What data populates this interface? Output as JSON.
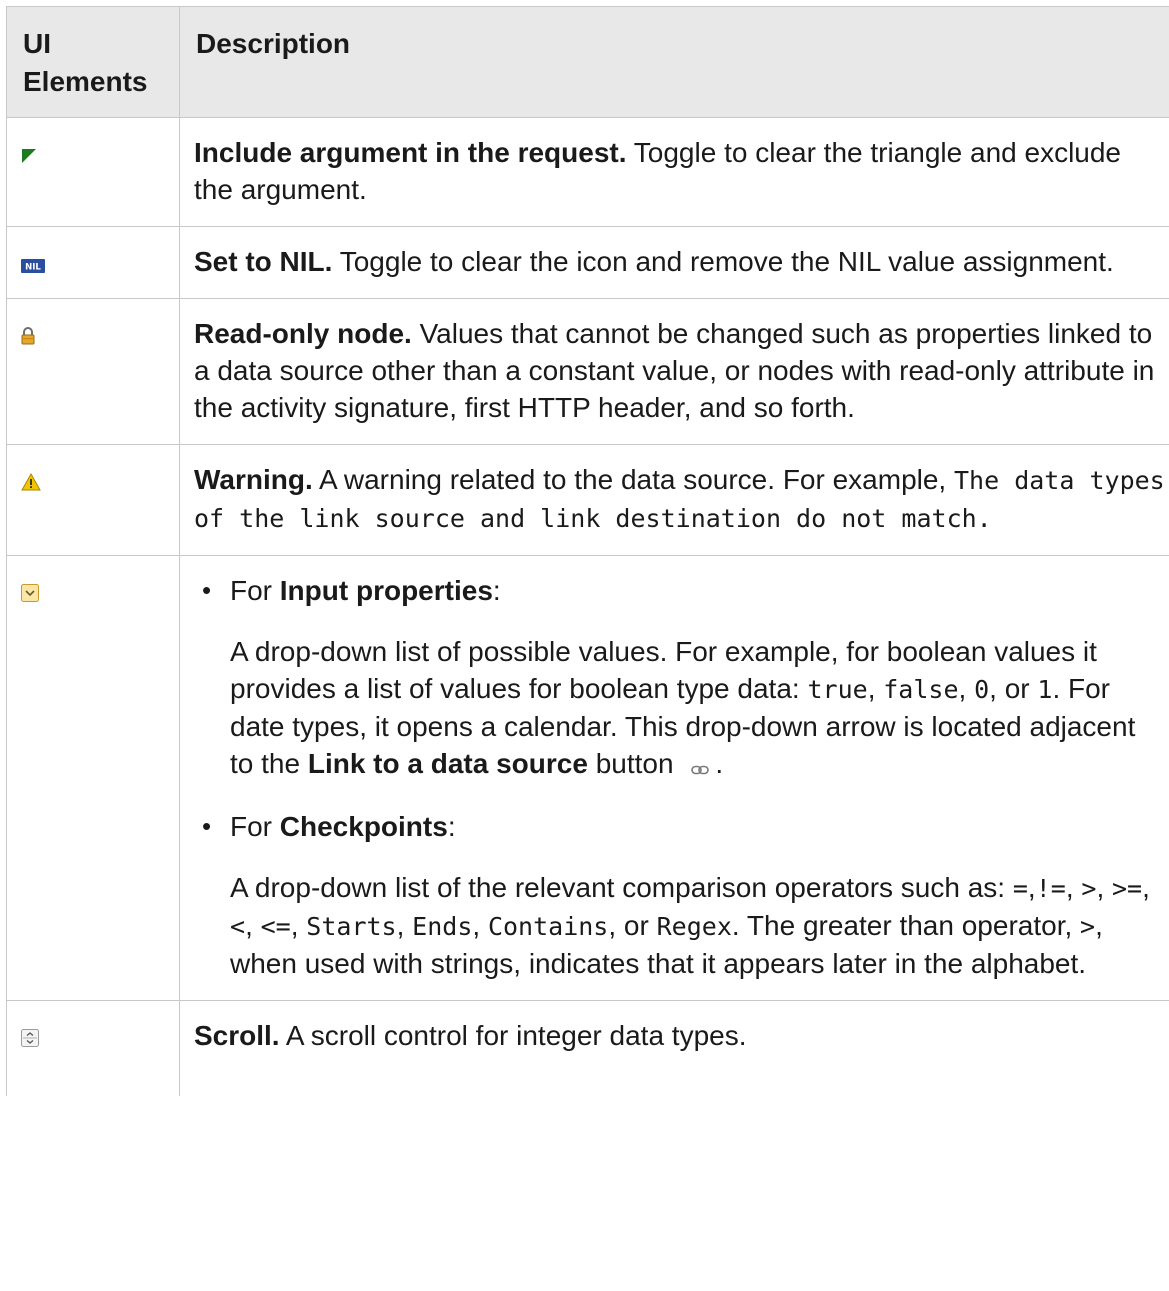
{
  "table": {
    "headers": {
      "col1": "UI Elements",
      "col1_line1": "UI",
      "col1_line2": "Elements",
      "col2": "Description"
    },
    "rows": [
      {
        "icon": "green-triangle-icon",
        "title": "Include argument in the request.",
        "text": " Toggle to clear the triangle and exclude the argument."
      },
      {
        "icon": "nil-icon",
        "icon_label": "NIL",
        "title": "Set to NIL.",
        "text": " Toggle to clear the icon and remove the NIL value assignment."
      },
      {
        "icon": "lock-icon",
        "title": "Read-only node.",
        "text": " Values that cannot be changed such as properties linked to a data source other than a constant value, or nodes with read-only attribute in the activity signature, first HTTP header, and so forth."
      },
      {
        "icon": "warning-icon",
        "title": "Warning.",
        "text": " A warning related to the data source. For example, ",
        "code": "The data types of the link source and link destination do not match."
      },
      {
        "icon": "dropdown-arrow-icon",
        "bullet1_prefix": "For ",
        "bullet1_bold": "Input properties",
        "bullet1_suffix": ":",
        "para1_a": "A drop-down list of possible values. For example, for boolean values it provides a list of values for boolean type data: ",
        "code_true": "true",
        "sep1": ", ",
        "code_false": "false",
        "sep2": ", ",
        "code_zero": "0",
        "sep3": ", or ",
        "code_one": "1",
        "para1_b": ". For date types, it opens a calendar. This drop-down arrow is located adjacent to the ",
        "para1_bold": "Link to a data source",
        "para1_c": " button ",
        "para1_end": ".",
        "link_icon": "chain-link-icon",
        "bullet2_prefix": "For ",
        "bullet2_bold": "Checkpoints",
        "bullet2_suffix": ":",
        "para2_a": "A drop-down list of the relevant comparison operators such as: ",
        "ops": [
          "=",
          ",",
          "!=",
          ", ",
          ">",
          ", ",
          ">=",
          ", ",
          "<",
          ", ",
          "<=",
          ", ",
          "Starts",
          ", ",
          "Ends",
          ", ",
          "Contains",
          ", or ",
          "Regex"
        ],
        "para2_b": ". The greater than operator, ",
        "code_gt": ">",
        "para2_c": ", when used with strings, indicates that it appears later in the alphabet."
      },
      {
        "icon": "spinner-icon",
        "title": "Scroll.",
        "text": " A scroll control for integer data types."
      }
    ]
  },
  "colors": {
    "header_bg": "#e8e8e8",
    "border": "#c8c8c8",
    "triangle": "#1e7a1e",
    "nil_bg": "#2a4fa0",
    "warning": "#f2c500"
  }
}
